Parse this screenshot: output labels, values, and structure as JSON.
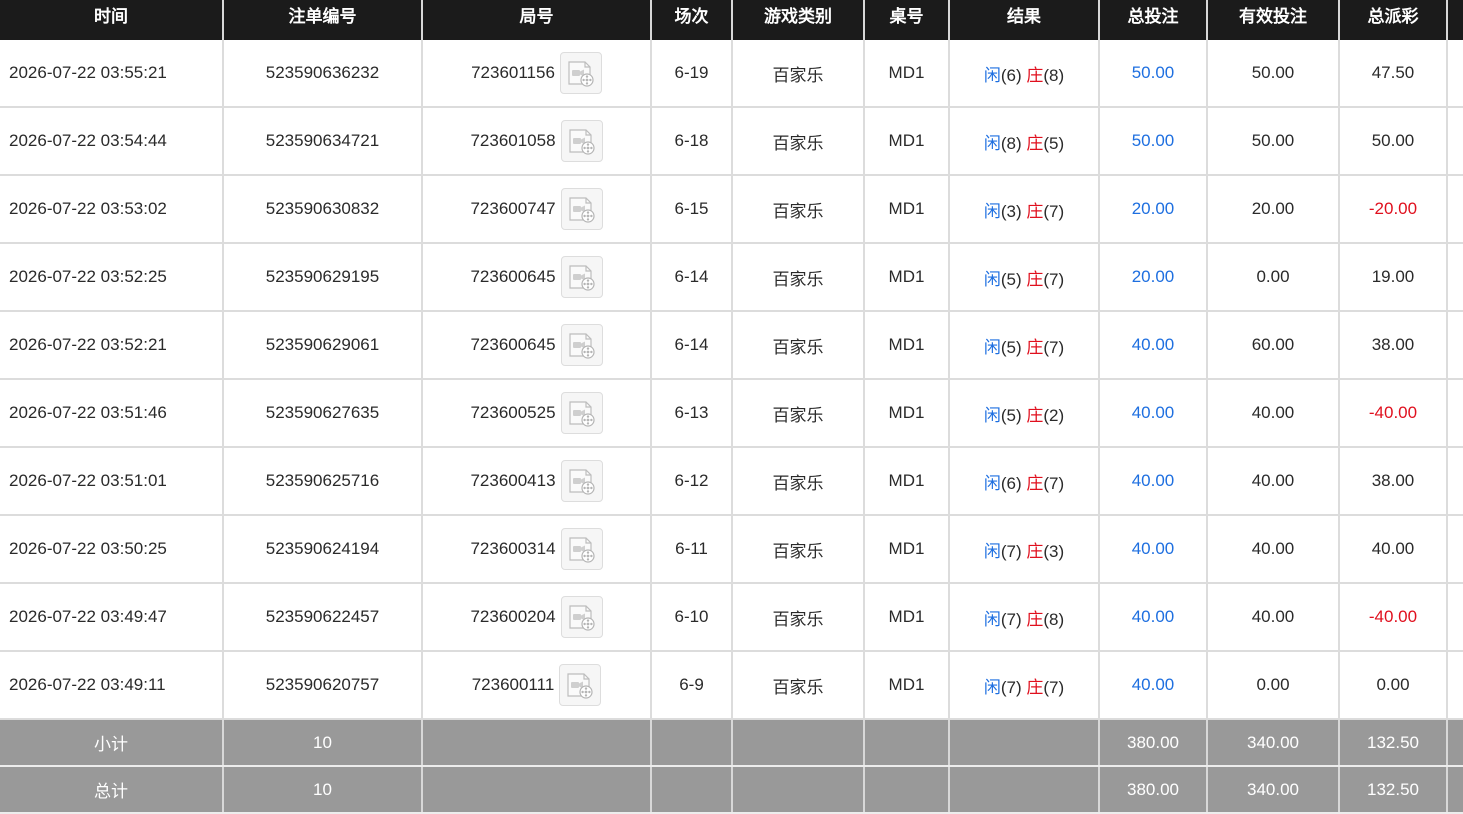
{
  "headers": [
    "时间",
    "注单编号",
    "局号",
    "场次",
    "游戏类别",
    "桌号",
    "结果",
    "总投注",
    "有效投注",
    "总派彩"
  ],
  "player_label": "闲",
  "banker_label": "庄",
  "rows": [
    {
      "time": "2026-07-22 03:55:21",
      "bet_id": "523590636232",
      "round": "723601156",
      "shoe": "6-19",
      "game": "百家乐",
      "table": "MD1",
      "player": "(6)",
      "banker": "(8)",
      "total_bet": "50.00",
      "valid_bet": "50.00",
      "payout": "47.50",
      "payout_negative": false
    },
    {
      "time": "2026-07-22 03:54:44",
      "bet_id": "523590634721",
      "round": "723601058",
      "shoe": "6-18",
      "game": "百家乐",
      "table": "MD1",
      "player": "(8)",
      "banker": "(5)",
      "total_bet": "50.00",
      "valid_bet": "50.00",
      "payout": "50.00",
      "payout_negative": false
    },
    {
      "time": "2026-07-22 03:53:02",
      "bet_id": "523590630832",
      "round": "723600747",
      "shoe": "6-15",
      "game": "百家乐",
      "table": "MD1",
      "player": "(3)",
      "banker": "(7)",
      "total_bet": "20.00",
      "valid_bet": "20.00",
      "payout": "-20.00",
      "payout_negative": true
    },
    {
      "time": "2026-07-22 03:52:25",
      "bet_id": "523590629195",
      "round": "723600645",
      "shoe": "6-14",
      "game": "百家乐",
      "table": "MD1",
      "player": "(5)",
      "banker": "(7)",
      "total_bet": "20.00",
      "valid_bet": "0.00",
      "payout": "19.00",
      "payout_negative": false
    },
    {
      "time": "2026-07-22 03:52:21",
      "bet_id": "523590629061",
      "round": "723600645",
      "shoe": "6-14",
      "game": "百家乐",
      "table": "MD1",
      "player": "(5)",
      "banker": "(7)",
      "total_bet": "40.00",
      "valid_bet": "60.00",
      "payout": "38.00",
      "payout_negative": false
    },
    {
      "time": "2026-07-22 03:51:46",
      "bet_id": "523590627635",
      "round": "723600525",
      "shoe": "6-13",
      "game": "百家乐",
      "table": "MD1",
      "player": "(5)",
      "banker": "(2)",
      "total_bet": "40.00",
      "valid_bet": "40.00",
      "payout": "-40.00",
      "payout_negative": true
    },
    {
      "time": "2026-07-22 03:51:01",
      "bet_id": "523590625716",
      "round": "723600413",
      "shoe": "6-12",
      "game": "百家乐",
      "table": "MD1",
      "player": "(6)",
      "banker": "(7)",
      "total_bet": "40.00",
      "valid_bet": "40.00",
      "payout": "38.00",
      "payout_negative": false
    },
    {
      "time": "2026-07-22 03:50:25",
      "bet_id": "523590624194",
      "round": "723600314",
      "shoe": "6-11",
      "game": "百家乐",
      "table": "MD1",
      "player": "(7)",
      "banker": "(3)",
      "total_bet": "40.00",
      "valid_bet": "40.00",
      "payout": "40.00",
      "payout_negative": false
    },
    {
      "time": "2026-07-22 03:49:47",
      "bet_id": "523590622457",
      "round": "723600204",
      "shoe": "6-10",
      "game": "百家乐",
      "table": "MD1",
      "player": "(7)",
      "banker": "(8)",
      "total_bet": "40.00",
      "valid_bet": "40.00",
      "payout": "-40.00",
      "payout_negative": true
    },
    {
      "time": "2026-07-22 03:49:11",
      "bet_id": "523590620757",
      "round": "723600111",
      "shoe": "6-9",
      "game": "百家乐",
      "table": "MD1",
      "player": "(7)",
      "banker": "(7)",
      "total_bet": "40.00",
      "valid_bet": "0.00",
      "payout": "0.00",
      "payout_negative": false
    }
  ],
  "subtotal": {
    "label": "小计",
    "count": "10",
    "total_bet": "380.00",
    "valid_bet": "340.00",
    "payout": "132.50"
  },
  "grand_total": {
    "label": "总计",
    "count": "10",
    "total_bet": "380.00",
    "valid_bet": "340.00",
    "payout": "132.50"
  },
  "colors": {
    "header_bg": "#1b1b1b",
    "footer_bg": "#999999",
    "blue": "#1e6fe0",
    "red": "#e0101e"
  },
  "icons": {
    "replay": "video-replay-icon"
  }
}
